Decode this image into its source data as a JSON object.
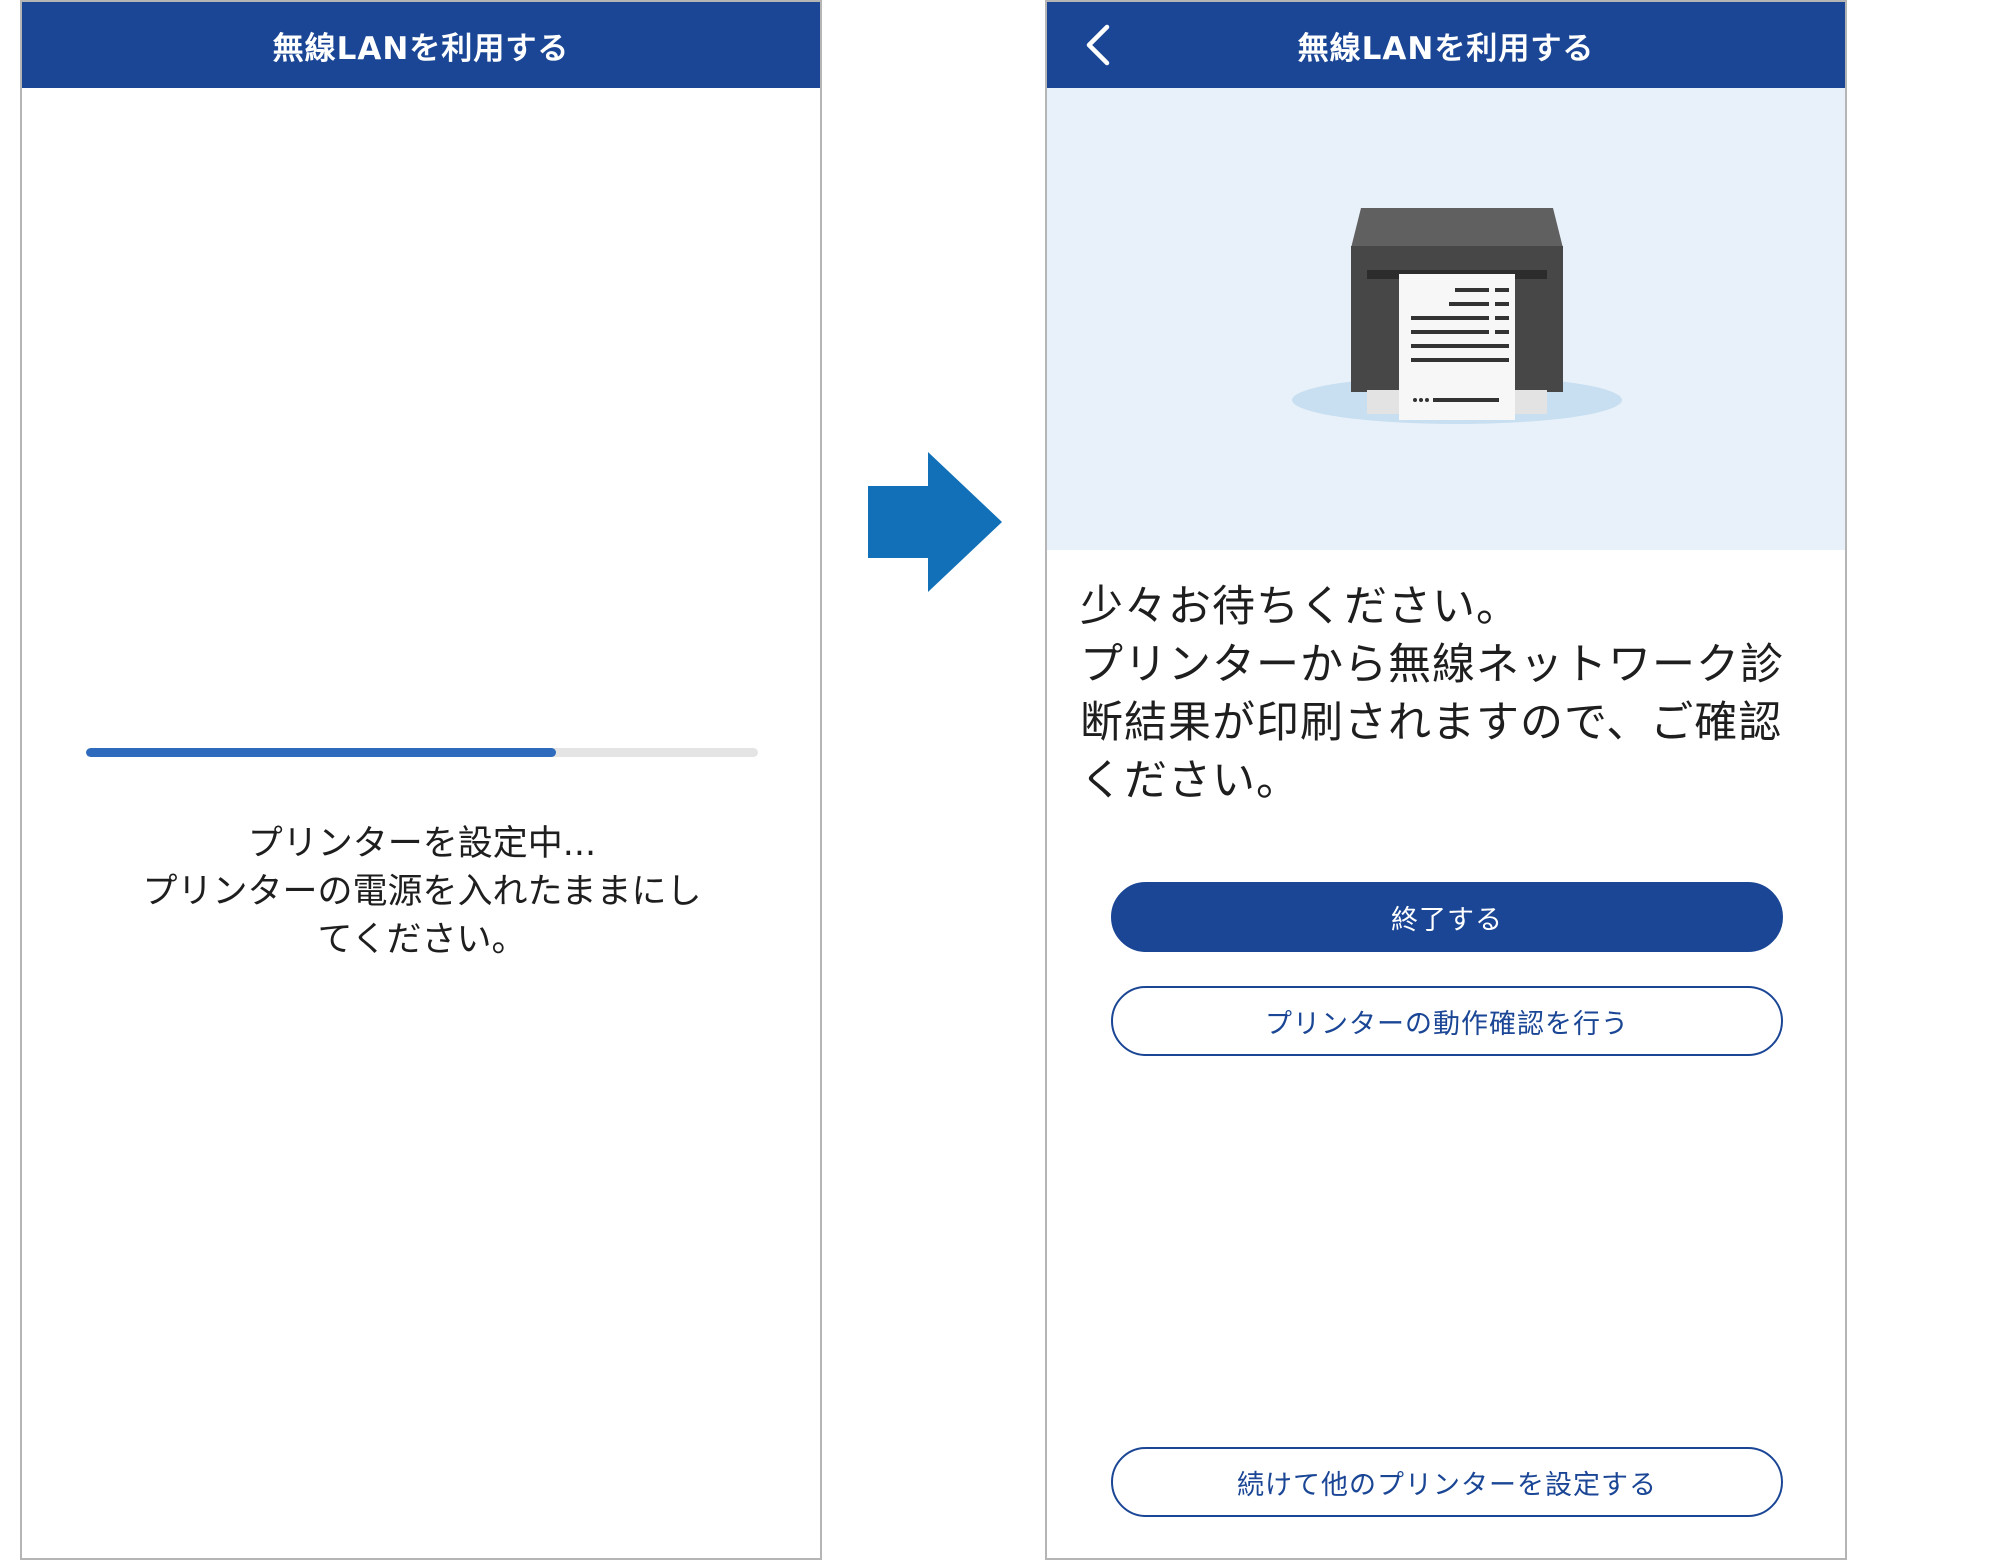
{
  "left_screen": {
    "header_title": "無線LANを利用する",
    "progress_percent": 70,
    "status_lines": [
      "プリンターを設定中...",
      "プリンターの電源を入れたままにし",
      "てください。"
    ]
  },
  "right_screen": {
    "header_title": "無線LANを利用する",
    "back_icon": "chevron-left-icon",
    "message_lines": [
      "少々お待ちください。",
      "プリンターから無線ネットワーク診",
      "断結果が印刷されますので、ご確認",
      "ください。"
    ],
    "buttons": {
      "finish": "終了する",
      "check_printer": "プリンターの動作確認を行う",
      "setup_another": "続けて他のプリンターを設定する"
    }
  },
  "colors": {
    "header_bg": "#1a4695",
    "progress": "#2e6bbd",
    "arrow": "#1170b8",
    "illustration_bg": "#e8f1f9"
  }
}
